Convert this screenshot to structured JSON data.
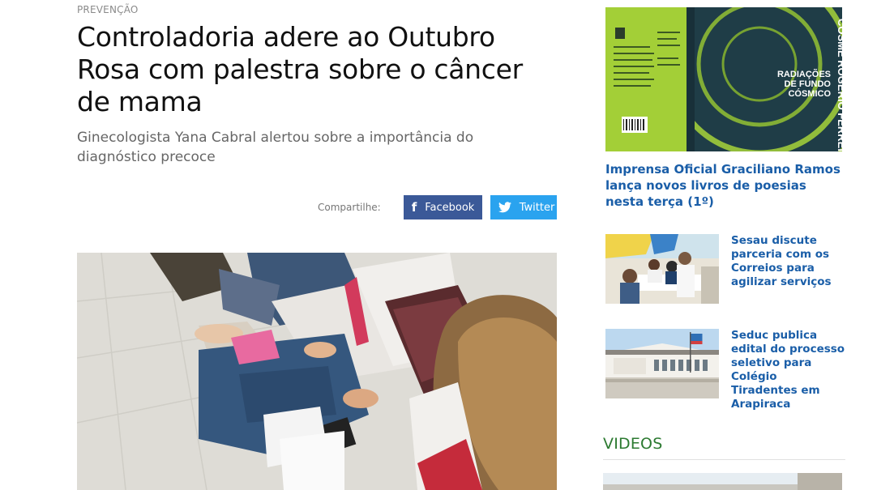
{
  "article": {
    "category": "PREVENÇÃO",
    "headline": "Controladoria adere ao Outubro Rosa com palestra sobre o câncer de mama",
    "subtitle": "Ginecologista Yana Cabral alertou sobre a importância do diagnóstico precoce",
    "share": {
      "label": "Compartilhe:",
      "facebook": "Facebook",
      "twitter": "Twitter"
    }
  },
  "sidebar": {
    "book_cover": {
      "lines": [
        "COSME",
        "ROGÉRIO",
        "FERREIRA",
        "RADIAÇÕES",
        "DE FUNDO",
        "CÓSMICO"
      ]
    },
    "lead_link": "Imprensa Oficial Graciliano Ramos lança novos livros de poesias nesta terça (1º)",
    "news": [
      {
        "title": "Sesau discute parceria com os Correios para agilizar serviços"
      },
      {
        "title": "Seduc publica edital do processo seletivo para Colégio Tiradentes em Arapiraca"
      }
    ],
    "videos_title": "VIDEOS"
  },
  "colors": {
    "facebook": "#3b5998",
    "twitter": "#2aa3ef",
    "link": "#1a5ea8",
    "section_green": "#2c7a31",
    "book_green": "#a7d43a"
  }
}
